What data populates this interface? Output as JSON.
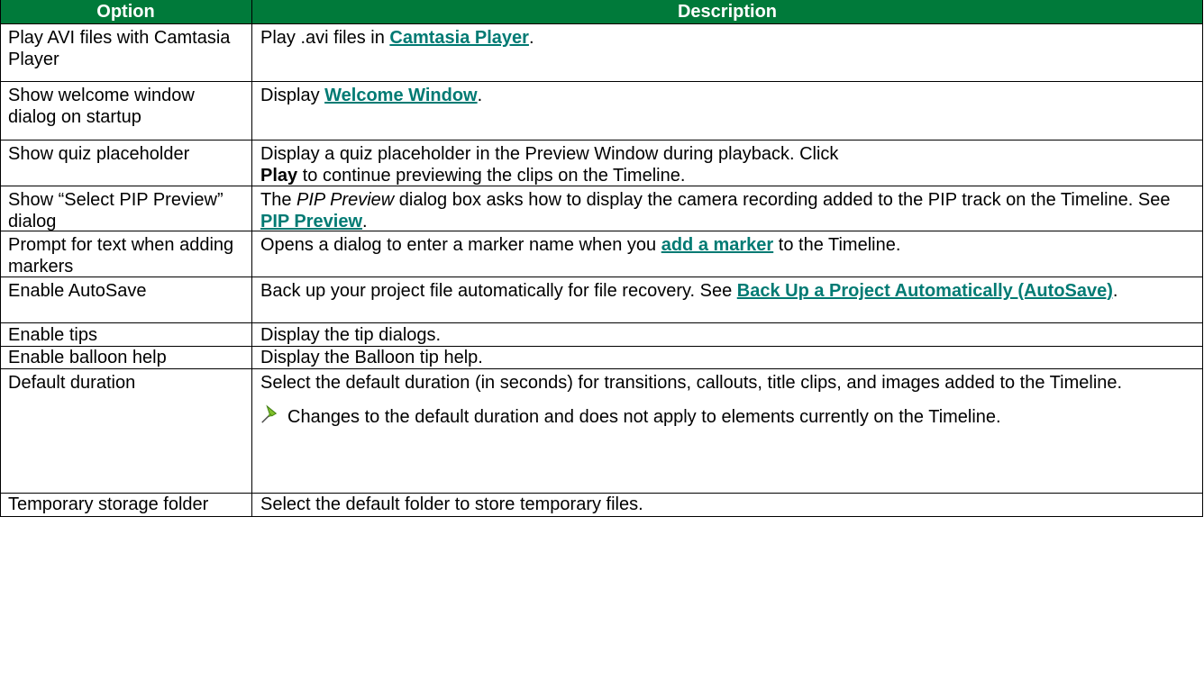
{
  "header": {
    "option": "Option",
    "description": "Description"
  },
  "rows": [
    {
      "option": "Play AVI files with Camtasia Player",
      "desc_before": "Play .avi files in ",
      "link": "Camtasia Player",
      "desc_after": "."
    },
    {
      "option": "Show welcome window dialog on startup",
      "desc_before": "Display ",
      "link": "Welcome Window",
      "desc_after": "."
    },
    {
      "option": "Show quiz placeholder",
      "desc_line1": "Display a quiz placeholder in the Preview Window during playback. Click",
      "bold": "Play",
      "desc_line2": " to continue previewing the clips on the Timeline."
    },
    {
      "option": "Show “Select PIP Preview” dialog",
      "italic": "PIP Preview",
      "desc_before": "The ",
      "desc_mid": " dialog box asks how to display the camera recording added to the PIP track on the Timeline. See ",
      "link": "PIP Preview",
      "desc_after": "."
    },
    {
      "option": "Prompt for text when adding markers",
      "desc_before": "Opens a dialog to enter a marker name when you ",
      "link": "add a marker",
      "desc_after": " to the Timeline."
    },
    {
      "option": "Enable AutoSave",
      "desc_before": "Back up your project file automatically for file recovery. See ",
      "link": "Back Up a Project Automatically (AutoSave)",
      "desc_after": "."
    },
    {
      "option": "Enable tips",
      "desc": "Display the tip dialogs."
    },
    {
      "option": "Enable balloon help",
      "desc": "Display the Balloon tip help."
    },
    {
      "option": "Default duration",
      "desc": "Select the default duration (in seconds) for transitions, callouts, title clips, and images added to the Timeline.",
      "note": "Changes to the default duration and does not apply to elements currently on the Timeline.",
      "note_icon": "pushpin-icon"
    },
    {
      "option": "Temporary storage folder",
      "desc": "Select the default folder to store temporary files."
    }
  ],
  "colors": {
    "header_bg": "#007a3a",
    "link": "#007a73"
  }
}
